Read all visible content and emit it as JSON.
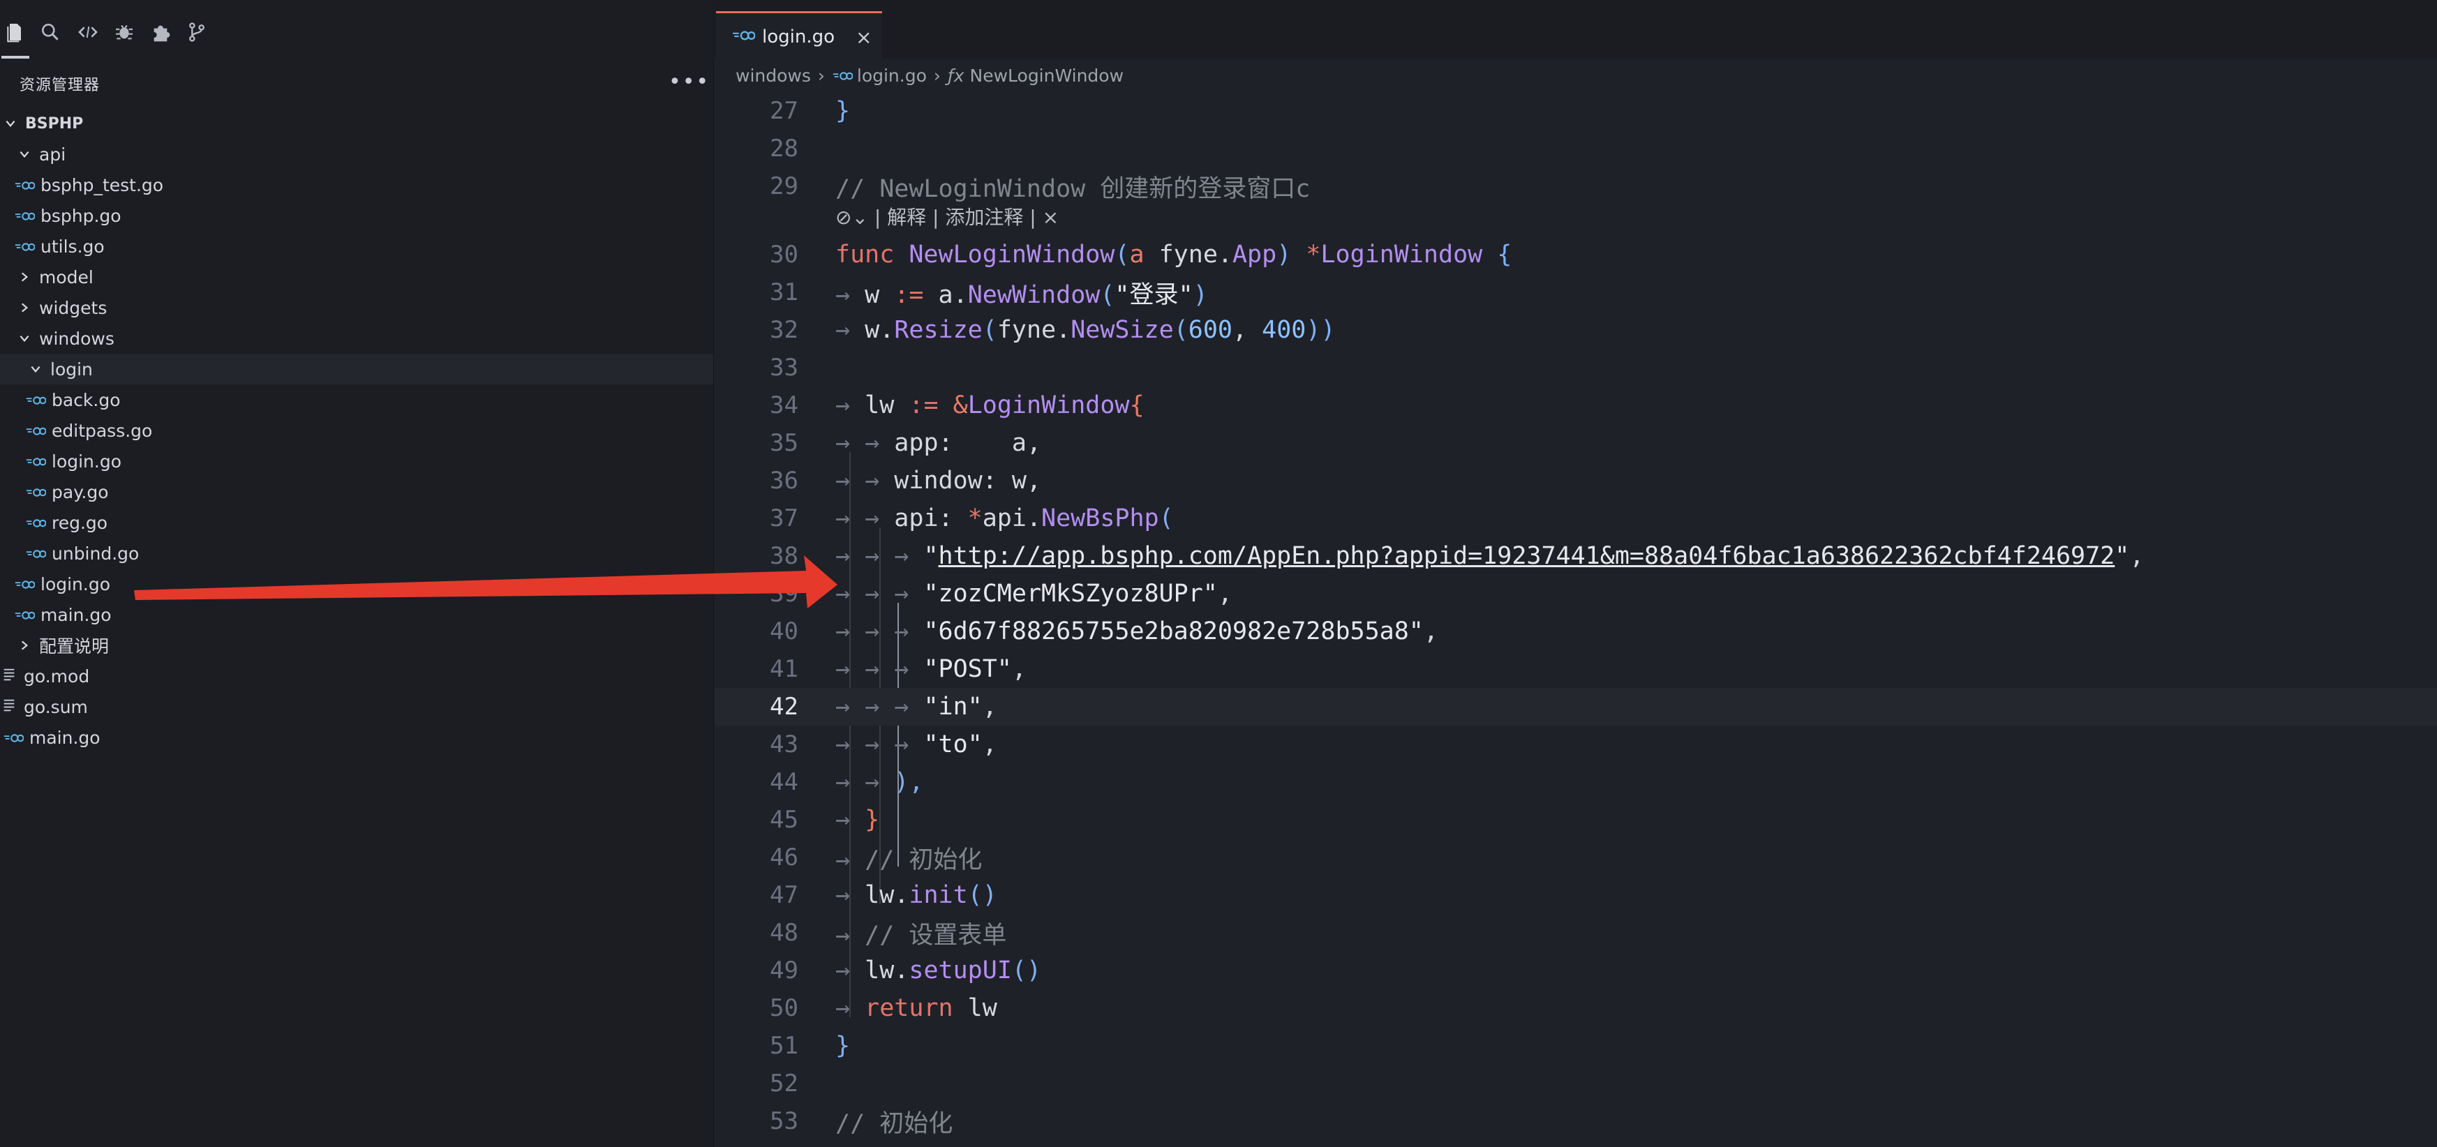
{
  "sidebar": {
    "explorer_title": "资源管理器",
    "more_label": "•••",
    "root_label": "BSPHP",
    "items": [
      {
        "label": "api",
        "kind": "folder-open",
        "indent": 1
      },
      {
        "label": "bsphp_test.go",
        "kind": "go",
        "indent": 2
      },
      {
        "label": "bsphp.go",
        "kind": "go",
        "indent": 2
      },
      {
        "label": "utils.go",
        "kind": "go",
        "indent": 2
      },
      {
        "label": "model",
        "kind": "folder-closed",
        "indent": 1
      },
      {
        "label": "widgets",
        "kind": "folder-closed",
        "indent": 1
      },
      {
        "label": "windows",
        "kind": "folder-open",
        "indent": 1
      },
      {
        "label": "login",
        "kind": "folder-open",
        "indent": 2,
        "active": true
      },
      {
        "label": "back.go",
        "kind": "go",
        "indent": 3
      },
      {
        "label": "editpass.go",
        "kind": "go",
        "indent": 3
      },
      {
        "label": "login.go",
        "kind": "go",
        "indent": 3
      },
      {
        "label": "pay.go",
        "kind": "go",
        "indent": 3
      },
      {
        "label": "reg.go",
        "kind": "go",
        "indent": 3
      },
      {
        "label": "unbind.go",
        "kind": "go",
        "indent": 3
      },
      {
        "label": "login.go",
        "kind": "go",
        "indent": 2
      },
      {
        "label": "main.go",
        "kind": "go",
        "indent": 2
      },
      {
        "label": "配置说明",
        "kind": "folder-closed",
        "indent": 1
      },
      {
        "label": "go.mod",
        "kind": "doc",
        "indent": 1
      },
      {
        "label": "go.sum",
        "kind": "doc",
        "indent": 1
      },
      {
        "label": "main.go",
        "kind": "go",
        "indent": 1
      }
    ]
  },
  "editor": {
    "tab_label": "login.go",
    "tab_close": "×",
    "breadcrumb": {
      "folder": "windows",
      "file": "login.go",
      "symbol_prefix": "ƒx",
      "symbol": "NewLoginWindow"
    },
    "codelens": "⊘⌄ | 解释 | 添加注释 | ×",
    "current_line": 42,
    "lines": [
      {
        "n": "27",
        "tokens": [
          [
            "par",
            "}"
          ]
        ]
      },
      {
        "n": "28",
        "tokens": []
      },
      {
        "n": "29",
        "tokens": [
          [
            "cm",
            "// NewLoginWindow 创建新的登录窗口c"
          ]
        ]
      },
      {
        "lens": true
      },
      {
        "n": "30",
        "tokens": [
          [
            "kw",
            "func "
          ],
          [
            "fn",
            "NewLoginWindow"
          ],
          [
            "par",
            "("
          ],
          [
            "kw2",
            "a"
          ],
          [
            "id",
            " fyne."
          ],
          [
            "ty",
            "App"
          ],
          [
            "par",
            ")"
          ],
          [
            "kw",
            " *"
          ],
          [
            "ty",
            "LoginWindow"
          ],
          [
            "par",
            " {"
          ]
        ]
      },
      {
        "n": "31",
        "tokens": [
          [
            "ar",
            "→ "
          ],
          [
            "id",
            "w "
          ],
          [
            "kw",
            ":="
          ],
          [
            "id",
            " a."
          ],
          [
            "fn",
            "NewWindow"
          ],
          [
            "par",
            "("
          ],
          [
            "str",
            "\"登录\""
          ],
          [
            "par",
            ")"
          ]
        ]
      },
      {
        "n": "32",
        "tokens": [
          [
            "ar",
            "→ "
          ],
          [
            "id",
            "w."
          ],
          [
            "fn",
            "Resize"
          ],
          [
            "par",
            "("
          ],
          [
            "id",
            "fyne."
          ],
          [
            "fn",
            "NewSize"
          ],
          [
            "par",
            "("
          ],
          [
            "num",
            "600"
          ],
          [
            "id",
            ", "
          ],
          [
            "num",
            "400"
          ],
          [
            "par",
            "))"
          ]
        ]
      },
      {
        "n": "33",
        "tokens": []
      },
      {
        "n": "34",
        "tokens": [
          [
            "ar",
            "→ "
          ],
          [
            "id",
            "lw "
          ],
          [
            "kw",
            ":="
          ],
          [
            "kw2",
            " &"
          ],
          [
            "ty",
            "LoginWindow"
          ],
          [
            "kw2",
            "{"
          ]
        ]
      },
      {
        "n": "35",
        "tokens": [
          [
            "ar",
            "→ → "
          ],
          [
            "id",
            "app:    a,"
          ]
        ]
      },
      {
        "n": "36",
        "tokens": [
          [
            "ar",
            "→ → "
          ],
          [
            "id",
            "window: w,"
          ]
        ]
      },
      {
        "n": "37",
        "tokens": [
          [
            "ar",
            "→ → "
          ],
          [
            "id",
            "api: "
          ],
          [
            "kw",
            "*"
          ],
          [
            "id",
            "api."
          ],
          [
            "fn",
            "NewBsPhp"
          ],
          [
            "par",
            "("
          ]
        ]
      },
      {
        "n": "38",
        "tokens": [
          [
            "ar",
            "→ → → "
          ],
          [
            "str",
            "\""
          ],
          [
            "url",
            "http://app.bsphp.com/AppEn.php?appid=19237441&m=88a04f6bac1a638622362cbf4f246972"
          ],
          [
            "str",
            "\""
          ],
          [
            "id",
            ","
          ]
        ]
      },
      {
        "n": "39",
        "tokens": [
          [
            "ar",
            "→ → → "
          ],
          [
            "str",
            "\"zozCMerMkSZyoz8UPr\""
          ],
          [
            "id",
            ","
          ]
        ]
      },
      {
        "n": "40",
        "tokens": [
          [
            "ar",
            "→ → → "
          ],
          [
            "str",
            "\"6d67f88265755e2ba820982e728b55a8\""
          ],
          [
            "id",
            ","
          ]
        ]
      },
      {
        "n": "41",
        "tokens": [
          [
            "ar",
            "→ → → "
          ],
          [
            "str",
            "\"POST\""
          ],
          [
            "id",
            ","
          ]
        ]
      },
      {
        "n": "42",
        "tokens": [
          [
            "ar",
            "→ → → "
          ],
          [
            "str",
            "\"in\""
          ],
          [
            "id",
            ","
          ]
        ]
      },
      {
        "n": "43",
        "tokens": [
          [
            "ar",
            "→ → → "
          ],
          [
            "str",
            "\"to\""
          ],
          [
            "id",
            ","
          ]
        ]
      },
      {
        "n": "44",
        "tokens": [
          [
            "ar",
            "→ → "
          ],
          [
            "par",
            "),"
          ]
        ]
      },
      {
        "n": "45",
        "tokens": [
          [
            "ar",
            "→ "
          ],
          [
            "kw2",
            "}"
          ]
        ]
      },
      {
        "n": "46",
        "tokens": [
          [
            "ar",
            "→ "
          ],
          [
            "cm",
            "// 初始化"
          ]
        ]
      },
      {
        "n": "47",
        "tokens": [
          [
            "ar",
            "→ "
          ],
          [
            "id",
            "lw."
          ],
          [
            "fn",
            "init"
          ],
          [
            "par",
            "()"
          ]
        ]
      },
      {
        "n": "48",
        "tokens": [
          [
            "ar",
            "→ "
          ],
          [
            "cm",
            "// 设置表单"
          ]
        ]
      },
      {
        "n": "49",
        "tokens": [
          [
            "ar",
            "→ "
          ],
          [
            "id",
            "lw."
          ],
          [
            "fn",
            "setupUI"
          ],
          [
            "par",
            "()"
          ]
        ]
      },
      {
        "n": "50",
        "tokens": [
          [
            "ar",
            "→ "
          ],
          [
            "kw",
            "return"
          ],
          [
            "id",
            " lw"
          ]
        ]
      },
      {
        "n": "51",
        "tokens": [
          [
            "par",
            "}"
          ]
        ]
      },
      {
        "n": "52",
        "tokens": []
      },
      {
        "n": "53",
        "tokens": [
          [
            "cm",
            "// 初始化"
          ]
        ]
      }
    ]
  },
  "colors": {
    "accent_tab": "#e96d58",
    "arrow": "#e5392b",
    "go_icon": "#5fb4e8"
  }
}
